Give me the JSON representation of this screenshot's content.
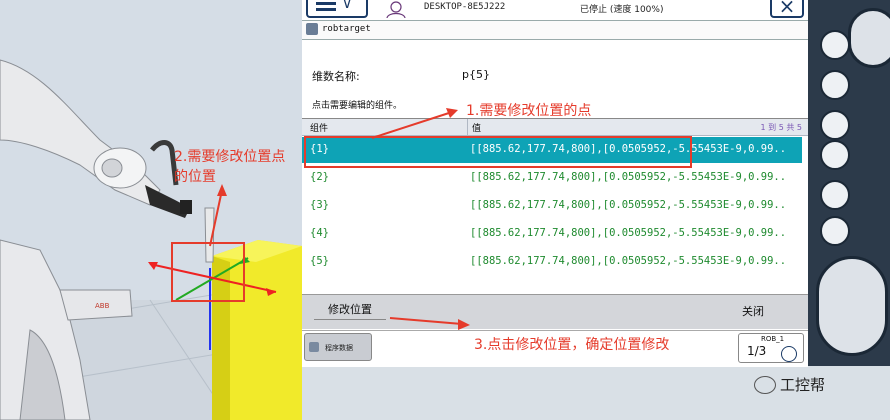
{
  "pendant": {
    "hostname": "DESKTOP-8E5J222",
    "state": "已停止 (速度 100%)",
    "close_glyph": "×",
    "subtitle": "robtarget",
    "name_label": "维数名称:",
    "name_value": "p{5}",
    "instruction": "点击需要编辑的组件。",
    "table": {
      "headers": [
        "组件",
        "值"
      ],
      "count": "1 到 5 共 5",
      "rows": [
        {
          "key": "{1}",
          "value": "[[885.62,177.74,800],[0.0505952,-5.55453E-9,0.99.."
        },
        {
          "key": "{2}",
          "value": "[[885.62,177.74,800],[0.0505952,-5.55453E-9,0.99.."
        },
        {
          "key": "{3}",
          "value": "[[885.62,177.74,800],[0.0505952,-5.55453E-9,0.99.."
        },
        {
          "key": "{4}",
          "value": "[[885.62,177.74,800],[0.0505952,-5.55453E-9,0.99.."
        },
        {
          "key": "{5}",
          "value": "[[885.62,177.74,800],[0.0505952,-5.55453E-9,0.99.."
        }
      ],
      "selected_index": 0
    },
    "modify_label": "修改位置",
    "close_label": "关闭",
    "taskbar": {
      "program_data_label": "程序数据",
      "rob_label": "ROB_1",
      "fraction": "1/3"
    }
  },
  "annotations": {
    "a1": "1.需要修改位置的点",
    "a2_line1": "2.需要修改位置点",
    "a2_line2": "的位置",
    "a3": "3.点击修改位置，确定位置修改"
  },
  "watermark": {
    "text": "工控帮"
  },
  "colors": {
    "selected_row": "#0ea3b6",
    "annotation": "#e53b2b",
    "row_text": "#1e8a2e"
  },
  "icons": {
    "menu": "menu-icon",
    "status": "operator-icon",
    "close": "close-icon",
    "subtitle": "data-icon",
    "program_data": "program-data-icon",
    "mode": "mode-icon"
  }
}
